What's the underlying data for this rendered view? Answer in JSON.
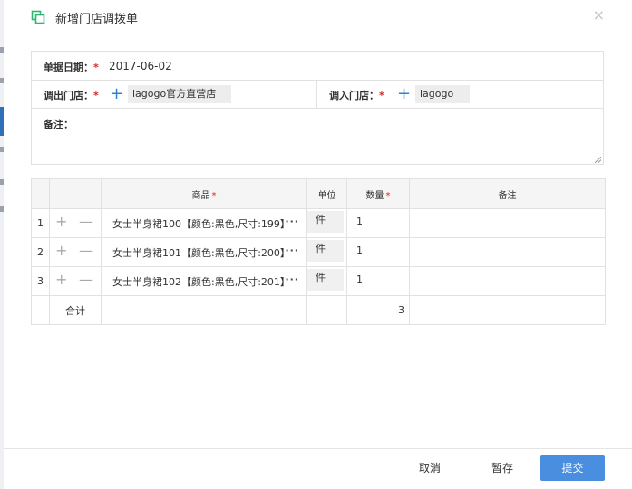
{
  "dialog": {
    "title": "新增门店调拨单",
    "close_icon": "close-icon",
    "title_icon": "copy-icon"
  },
  "form": {
    "date_label": "单据日期：",
    "date_required": "*",
    "date_value": "2017-06-02",
    "out_store_label": "调出门店：",
    "out_store_required": "*",
    "out_store_value": "lagogo官方直营店",
    "in_store_label": "调入门店：",
    "in_store_required": "*",
    "in_store_value": "lagogo",
    "remark_label": "备注："
  },
  "table": {
    "headers": {
      "product": "商品",
      "product_required": "*",
      "unit": "单位",
      "quantity": "数量",
      "quantity_required": "*",
      "remark": "备注"
    },
    "rows": [
      {
        "num": "1",
        "product": "女士半身裙100【颜色:黑色,尺寸:199】",
        "more": "···",
        "unit": "件",
        "quantity": "1",
        "remark": ""
      },
      {
        "num": "2",
        "product": "女士半身裙101【颜色:黑色,尺寸:200】",
        "more": "···",
        "unit": "件",
        "quantity": "1",
        "remark": ""
      },
      {
        "num": "3",
        "product": "女士半身裙102【颜色:黑色,尺寸:201】",
        "more": "···",
        "unit": "件",
        "quantity": "1",
        "remark": ""
      }
    ],
    "row_add_symbol": "+",
    "row_remove_symbol": "—",
    "total_label": "合计",
    "total_quantity": "3"
  },
  "footer": {
    "cancel_label": "取消",
    "save_label": "暂存",
    "submit_label": "提交"
  },
  "colors": {
    "accent": "#4a8ee0",
    "required": "#e02020",
    "title_icon": "#2bb673"
  }
}
